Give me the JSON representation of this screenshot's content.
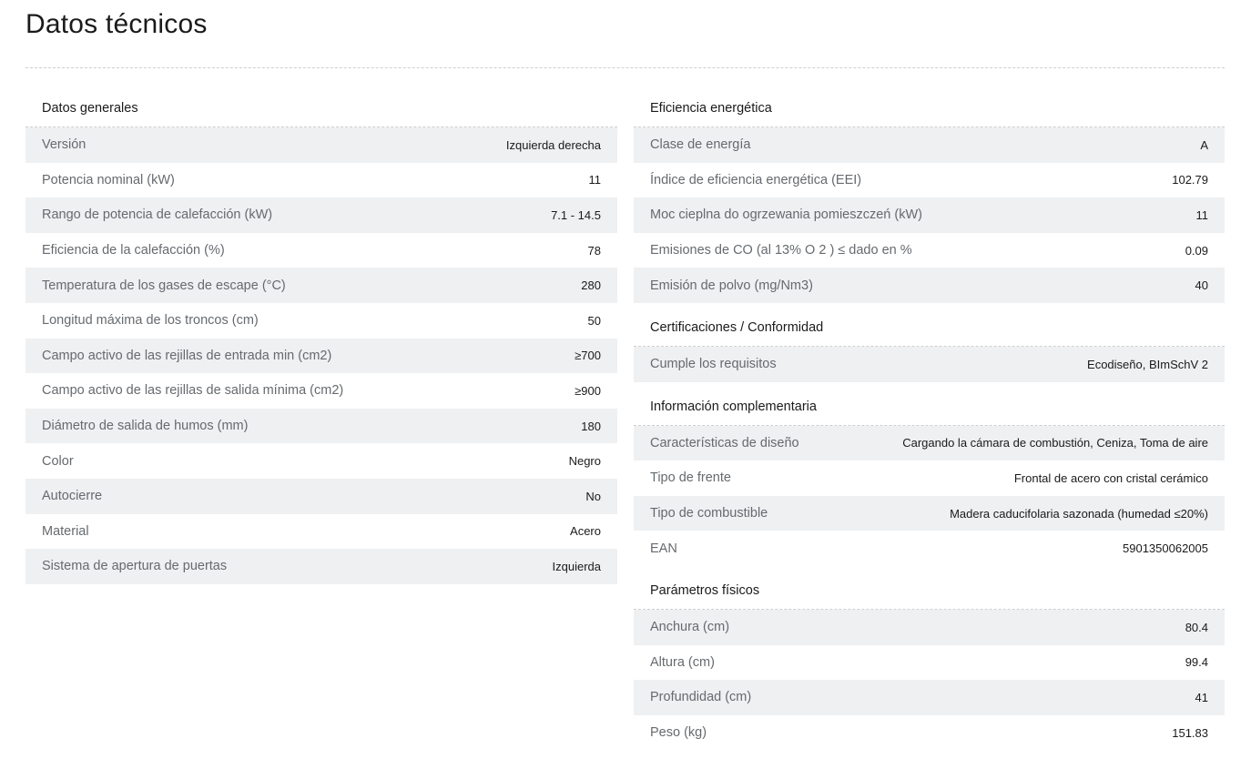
{
  "page": {
    "title": "Datos técnicos"
  },
  "left": {
    "sections": [
      {
        "heading": "Datos generales",
        "rows": [
          {
            "label": "Versión",
            "value": "Izquierda derecha"
          },
          {
            "label": "Potencia nominal (kW)",
            "value": "11"
          },
          {
            "label": "Rango de potencia de calefacción (kW)",
            "value": "7.1 - 14.5"
          },
          {
            "label": "Eficiencia de la calefacción (%)",
            "value": "78"
          },
          {
            "label": "Temperatura de los gases de escape (°C)",
            "value": "280"
          },
          {
            "label": "Longitud máxima de los troncos (cm)",
            "value": "50"
          },
          {
            "label": "Campo activo de las rejillas de entrada min (cm2)",
            "value": "≥700"
          },
          {
            "label": "Campo activo de las rejillas de salida mínima (cm2)",
            "value": "≥900"
          },
          {
            "label": "Diámetro de salida de humos (mm)",
            "value": "180"
          },
          {
            "label": "Color",
            "value": "Negro"
          },
          {
            "label": "Autocierre",
            "value": "No"
          },
          {
            "label": "Material",
            "value": "Acero"
          },
          {
            "label": "Sistema de apertura de puertas",
            "value": "Izquierda"
          }
        ]
      }
    ]
  },
  "right": {
    "sections": [
      {
        "heading": "Eficiencia energética",
        "rows": [
          {
            "label": "Clase de energía",
            "value": "A"
          },
          {
            "label": "Índice de eficiencia energética (EEI)",
            "value": "102.79"
          },
          {
            "label": "Moc cieplna do ogrzewania pomieszczeń (kW)",
            "value": "11"
          },
          {
            "label": "Emisiones de CO (al 13% O 2 ) ≤ dado en %",
            "value": "0.09"
          },
          {
            "label": "Emisión de polvo (mg/Nm3)",
            "value": "40"
          }
        ]
      },
      {
        "heading": "Certificaciones / Conformidad",
        "rows": [
          {
            "label": "Cumple los requisitos",
            "value": "Ecodiseño, BImSchV 2"
          }
        ]
      },
      {
        "heading": "Información complementaria",
        "rows": [
          {
            "label": "Características de diseño",
            "value": "Cargando la cámara de combustión, Ceniza, Toma de aire"
          },
          {
            "label": "Tipo de frente",
            "value": "Frontal de acero con cristal cerámico"
          },
          {
            "label": "Tipo de combustible",
            "value": "Madera caducifolaria sazonada (humedad ≤20%)"
          },
          {
            "label": "EAN",
            "value": "5901350062005"
          }
        ]
      },
      {
        "heading": "Parámetros físicos",
        "rows": [
          {
            "label": "Anchura (cm)",
            "value": "80.4"
          },
          {
            "label": "Altura (cm)",
            "value": "99.4"
          },
          {
            "label": "Profundidad (cm)",
            "value": "41"
          },
          {
            "label": "Peso (kg)",
            "value": "151.83"
          }
        ]
      }
    ]
  }
}
